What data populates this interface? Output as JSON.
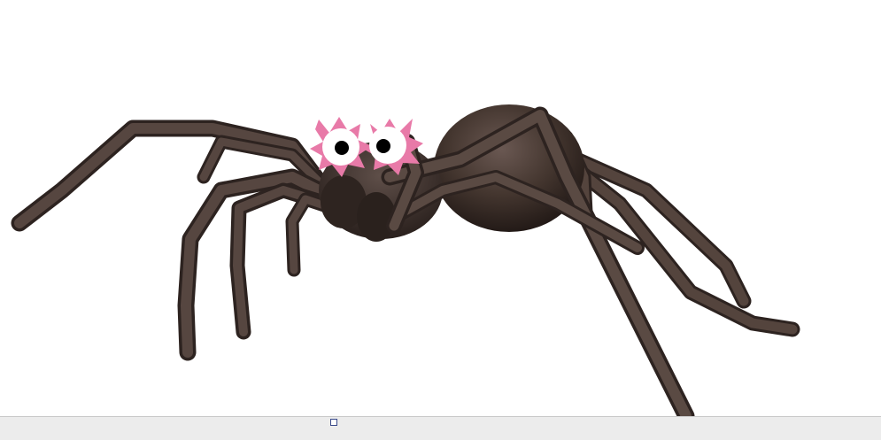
{
  "scene": {
    "subject_icon": "spider-icon",
    "colors": {
      "background": "#ffffff",
      "leg": "#4a3b36",
      "leg_dark": "#2c221f",
      "leg_light": "#6e5b54",
      "body": "#3a302c",
      "eye_ring": "#e87aa8",
      "eye_white": "#ffffff",
      "pupil": "#000000"
    }
  },
  "bottom_bar": {
    "handle_icon": "resize-handle-icon",
    "color": "#ececec"
  }
}
